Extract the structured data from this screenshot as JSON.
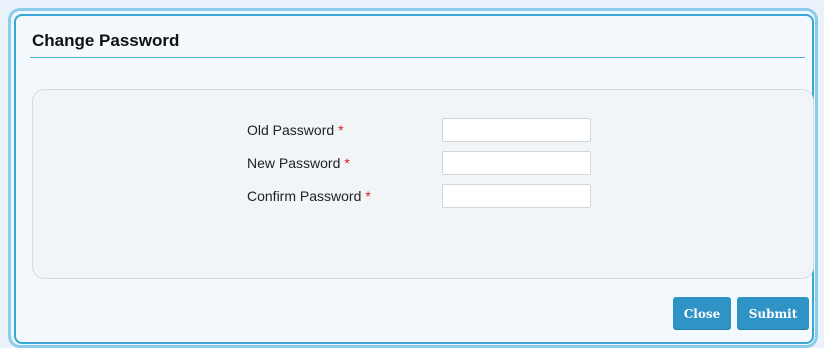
{
  "dialog": {
    "title": "Change Password"
  },
  "form": {
    "fields": [
      {
        "label": "Old Password",
        "required_mark": "*",
        "value": ""
      },
      {
        "label": "New Password",
        "required_mark": "*",
        "value": ""
      },
      {
        "label": "Confirm Password",
        "required_mark": "*",
        "value": ""
      }
    ]
  },
  "buttons": {
    "close_label": "Close",
    "submit_label": "Submit"
  },
  "colors": {
    "accent": "#2f93c6",
    "border": "#3aa6d6",
    "required": "#d62020"
  }
}
